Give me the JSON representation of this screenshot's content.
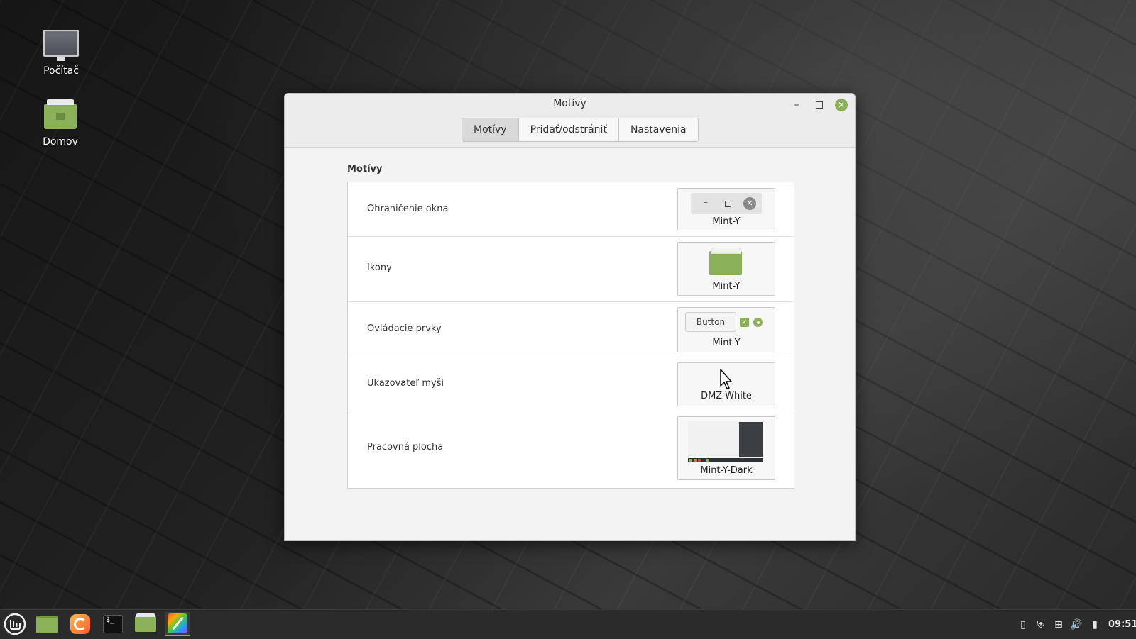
{
  "desktop": {
    "icons": [
      {
        "label": "Počítač",
        "icon": "computer-icon"
      },
      {
        "label": "Domov",
        "icon": "home-folder-icon"
      }
    ]
  },
  "window": {
    "title": "Motívy",
    "tabs": [
      {
        "label": "Motívy",
        "active": true
      },
      {
        "label": "Pridať/odstrániť",
        "active": false
      },
      {
        "label": "Nastavenia",
        "active": false
      }
    ],
    "section_title": "Motívy",
    "rows": [
      {
        "label": "Ohraničenie okna",
        "value": "Mint-Y"
      },
      {
        "label": "Ikony",
        "value": "Mint-Y"
      },
      {
        "label": "Ovládacie prvky",
        "value": "Mint-Y",
        "preview_button": "Button"
      },
      {
        "label": "Ukazovateľ myši",
        "value": "DMZ-White"
      },
      {
        "label": "Pracovná plocha",
        "value": "Mint-Y-Dark"
      }
    ]
  },
  "taskbar": {
    "apps": [
      "menu-icon",
      "show-desktop-icon",
      "firefox-icon",
      "terminal-icon",
      "files-icon",
      "themes-icon"
    ],
    "tray": [
      "clipboard-icon",
      "shield-icon",
      "network-icon",
      "volume-icon",
      "battery-icon"
    ],
    "clock": "09:51"
  },
  "colors": {
    "accent": "#8bb158",
    "panel": "#2b2b2b"
  }
}
